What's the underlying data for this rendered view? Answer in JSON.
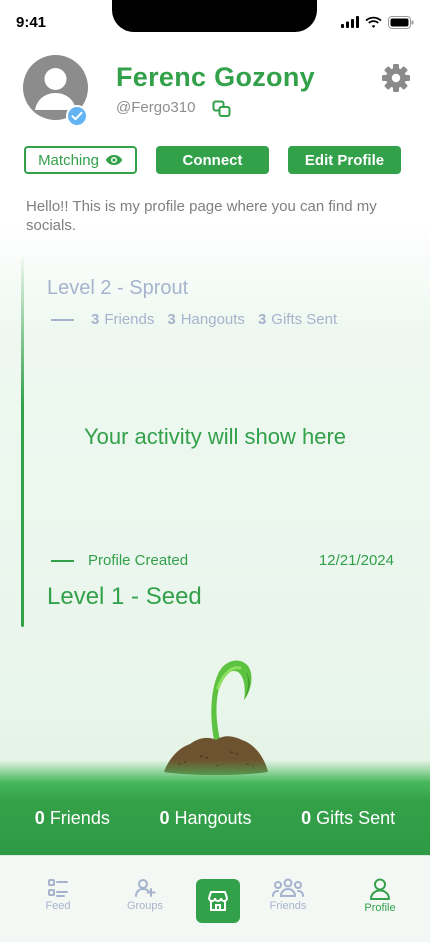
{
  "status_bar": {
    "time": "9:41"
  },
  "profile": {
    "name": "Ferenc Gozony",
    "handle": "@Fergo310",
    "bio": "Hello!! This is my profile page where you can find my socials."
  },
  "actions": {
    "matching_label": "Matching",
    "connect_label": "Connect",
    "edit_profile_label": "Edit Profile"
  },
  "timeline": {
    "next_level": "Level 2 - Sprout",
    "next_level_requirements": [
      {
        "count": "3",
        "label": "Friends"
      },
      {
        "count": "3",
        "label": "Hangouts"
      },
      {
        "count": "3",
        "label": "Gifts Sent"
      }
    ],
    "empty_message": "Your activity will show here",
    "event_label": "Profile Created",
    "event_date": "12/21/2024",
    "current_level": "Level 1 - Seed"
  },
  "stats": [
    {
      "count": "0",
      "label": "Friends"
    },
    {
      "count": "0",
      "label": "Hangouts"
    },
    {
      "count": "0",
      "label": "Gifts Sent"
    }
  ],
  "tabbar": {
    "items": [
      {
        "label": "Feed",
        "icon": "feed-icon"
      },
      {
        "label": "Groups",
        "icon": "add-group-icon"
      },
      {
        "label": "",
        "icon": "store-icon"
      },
      {
        "label": "Friends",
        "icon": "friends-icon"
      },
      {
        "label": "Profile",
        "icon": "profile-icon"
      }
    ],
    "active": "Profile"
  },
  "colors": {
    "brand_green": "#33a04a",
    "muted_blue": "#a6b3cc",
    "verified_blue": "#62b4f4"
  }
}
